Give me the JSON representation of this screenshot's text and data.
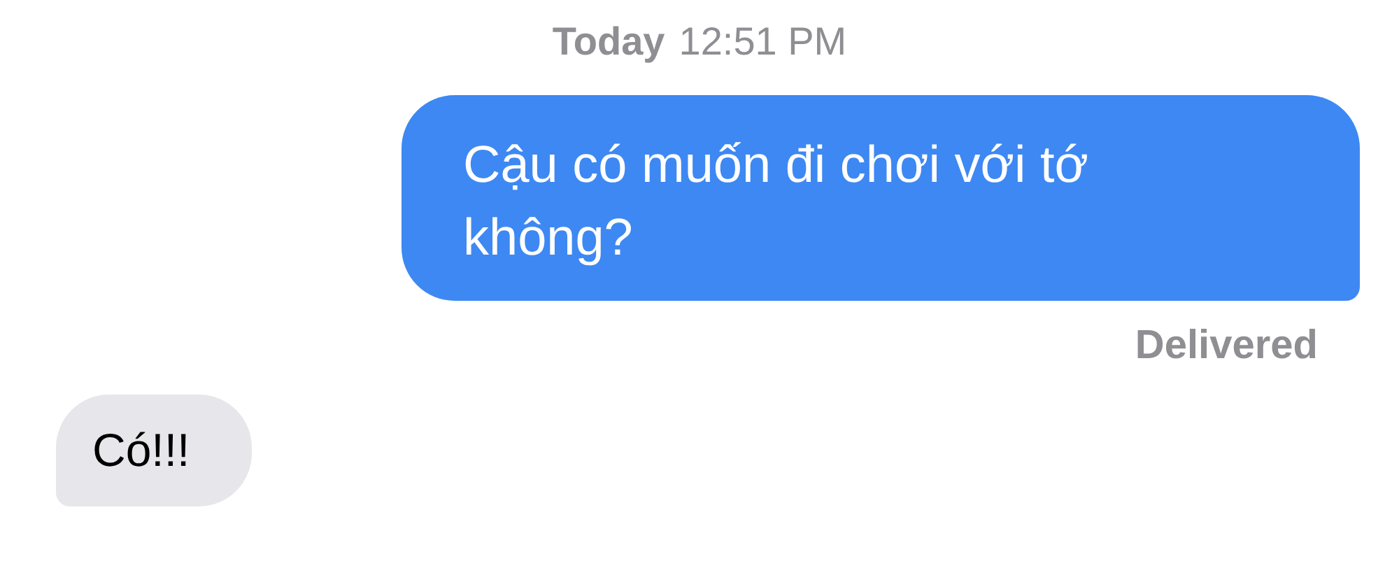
{
  "timestamp": {
    "day": "Today",
    "time": "12:51 PM"
  },
  "messages": [
    {
      "kind": "outgoing",
      "text": "Cậu có muốn đi chơi với tớ không?",
      "status": "Delivered"
    },
    {
      "kind": "incoming",
      "text": "Có!!!"
    }
  ]
}
